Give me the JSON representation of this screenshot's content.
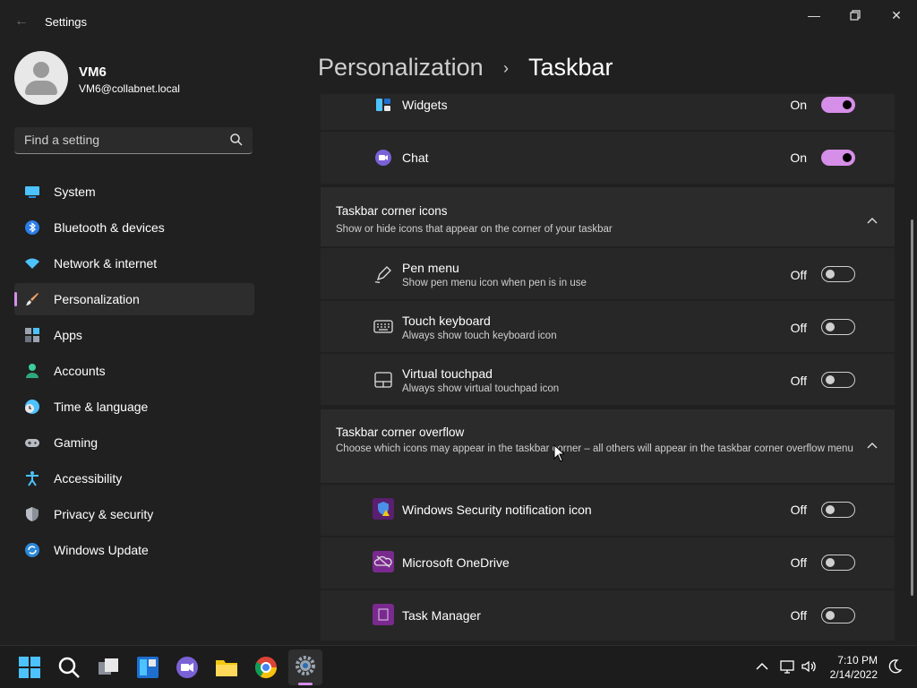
{
  "window": {
    "title": "Settings"
  },
  "profile": {
    "name": "VM6",
    "email": "VM6@collabnet.local"
  },
  "search": {
    "placeholder": "Find a setting"
  },
  "nav": [
    {
      "label": "System",
      "icon": "system-icon"
    },
    {
      "label": "Bluetooth & devices",
      "icon": "bluetooth-icon"
    },
    {
      "label": "Network & internet",
      "icon": "wifi-icon"
    },
    {
      "label": "Personalization",
      "icon": "brush-icon",
      "selected": true
    },
    {
      "label": "Apps",
      "icon": "apps-icon"
    },
    {
      "label": "Accounts",
      "icon": "accounts-icon"
    },
    {
      "label": "Time & language",
      "icon": "clock-globe-icon"
    },
    {
      "label": "Gaming",
      "icon": "gamepad-icon"
    },
    {
      "label": "Accessibility",
      "icon": "accessibility-icon"
    },
    {
      "label": "Privacy & security",
      "icon": "shield-icon"
    },
    {
      "label": "Windows Update",
      "icon": "update-icon"
    }
  ],
  "header": {
    "parent": "Personalization",
    "separator": "›",
    "current": "Taskbar"
  },
  "items": {
    "widgets": {
      "title": "Widgets",
      "state": "On"
    },
    "chat": {
      "title": "Chat",
      "state": "On"
    }
  },
  "corner_icons": {
    "title": "Taskbar corner icons",
    "subtitle": "Show or hide icons that appear on the corner of your taskbar",
    "items": [
      {
        "title": "Pen menu",
        "subtitle": "Show pen menu icon when pen is in use",
        "state": "Off"
      },
      {
        "title": "Touch keyboard",
        "subtitle": "Always show touch keyboard icon",
        "state": "Off"
      },
      {
        "title": "Virtual touchpad",
        "subtitle": "Always show virtual touchpad icon",
        "state": "Off"
      }
    ]
  },
  "corner_overflow": {
    "title": "Taskbar corner overflow",
    "subtitle": "Choose which icons may appear in the taskbar corner – all others will appear in the taskbar corner overflow menu",
    "items": [
      {
        "title": "Windows Security notification icon",
        "state": "Off"
      },
      {
        "title": "Microsoft OneDrive",
        "state": "Off"
      },
      {
        "title": "Task Manager",
        "state": "Off"
      }
    ]
  },
  "clock": {
    "time": "7:10 PM",
    "date": "2/14/2022"
  },
  "colors": {
    "accent": "#d58fe8",
    "background": "#202020",
    "card": "#2b2b2b"
  }
}
